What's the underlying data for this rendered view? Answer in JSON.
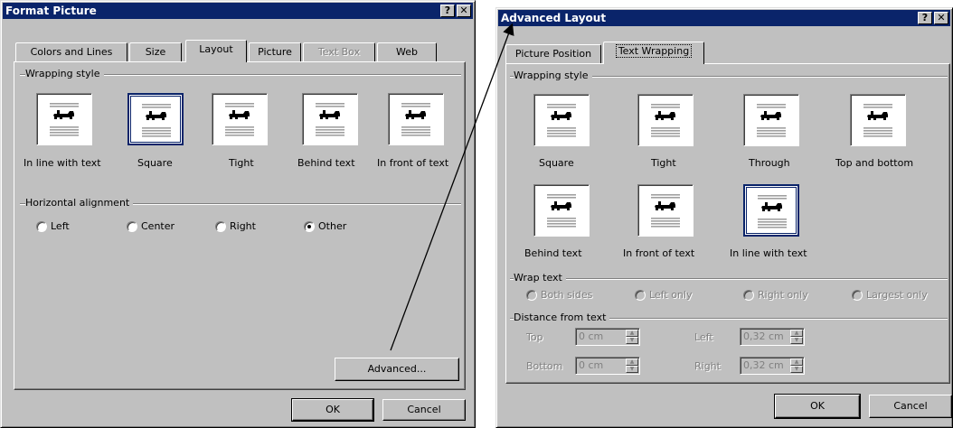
{
  "format_picture": {
    "title": "Format Picture",
    "title_buttons": [
      "?",
      "✕"
    ],
    "tabs": [
      "Colors and Lines",
      "Size",
      "Layout",
      "Picture",
      "Text Box",
      "Web"
    ],
    "wrapping_style_label": "Wrapping style",
    "wrapping_styles": [
      "In line with text",
      "Square",
      "Tight",
      "Behind text",
      "In front of text"
    ],
    "horizontal_alignment_label": "Horizontal alignment",
    "alignments": [
      "Left",
      "Center",
      "Right",
      "Other"
    ],
    "selected_alignment": "Other",
    "selected_wrapping": "Square",
    "advanced_button": "Advanced...",
    "ok_button": "OK",
    "cancel_button": "Cancel"
  },
  "advanced_layout": {
    "title": "Advanced Layout",
    "title_buttons": [
      "?",
      "✕"
    ],
    "tabs": [
      "Picture Position",
      "Text Wrapping"
    ],
    "wrapping_style_label": "Wrapping style",
    "wrapping_styles": [
      "Square",
      "Tight",
      "Through",
      "Top and bottom",
      "Behind text",
      "In front of text",
      "In line with text"
    ],
    "selected_wrapping": "In line with text",
    "wrap_text_label": "Wrap text",
    "wrap_text_options": [
      "Both sides",
      "Left only",
      "Right only",
      "Largest only"
    ],
    "distance_label": "Distance from text",
    "distance": {
      "top_label": "Top",
      "top_value": "0 cm",
      "bottom_label": "Bottom",
      "bottom_value": "0 cm",
      "left_label": "Left",
      "left_value": "0,32 cm",
      "right_label": "Right",
      "right_value": "0,32 cm"
    },
    "ok_button": "OK",
    "cancel_button": "Cancel"
  },
  "colors": {
    "title_bar": "#0a246a",
    "face": "#c0c0c0",
    "arrow": "#000000"
  }
}
